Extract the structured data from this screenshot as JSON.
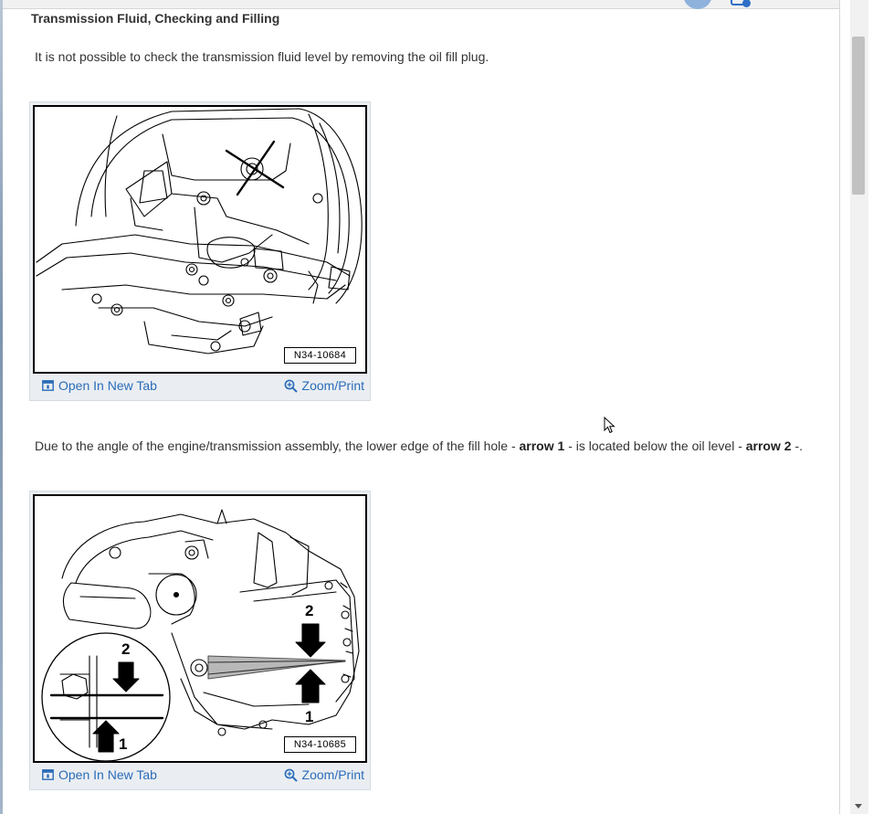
{
  "page": {
    "title": "Transmission Fluid, Checking and Filling",
    "para1": "It is not possible to check the transmission fluid level by removing the oil fill plug.",
    "para2": {
      "t1": "Due to the angle of the engine/transmission assembly, the lower edge of the fill hole - ",
      "b1": "arrow 1",
      "t2": " - is located below the oil level - ",
      "b2": "arrow 2",
      "t3": " -."
    }
  },
  "figures": [
    {
      "code": "N34-10684",
      "open_label": "Open In New Tab",
      "zoom_label": "Zoom/Print",
      "open_icon": "open-in-new-tab-icon",
      "zoom_icon": "magnifier-zoom-icon"
    },
    {
      "code": "N34-10685",
      "open_label": "Open In New Tab",
      "zoom_label": "Zoom/Print",
      "open_icon": "open-in-new-tab-icon",
      "zoom_icon": "magnifier-zoom-icon",
      "arrow_labels": [
        "2",
        "1",
        "2",
        "1"
      ]
    }
  ],
  "colors": {
    "link": "#2b6cb8",
    "text": "#333333",
    "figure_bg": "#eaeef2"
  }
}
